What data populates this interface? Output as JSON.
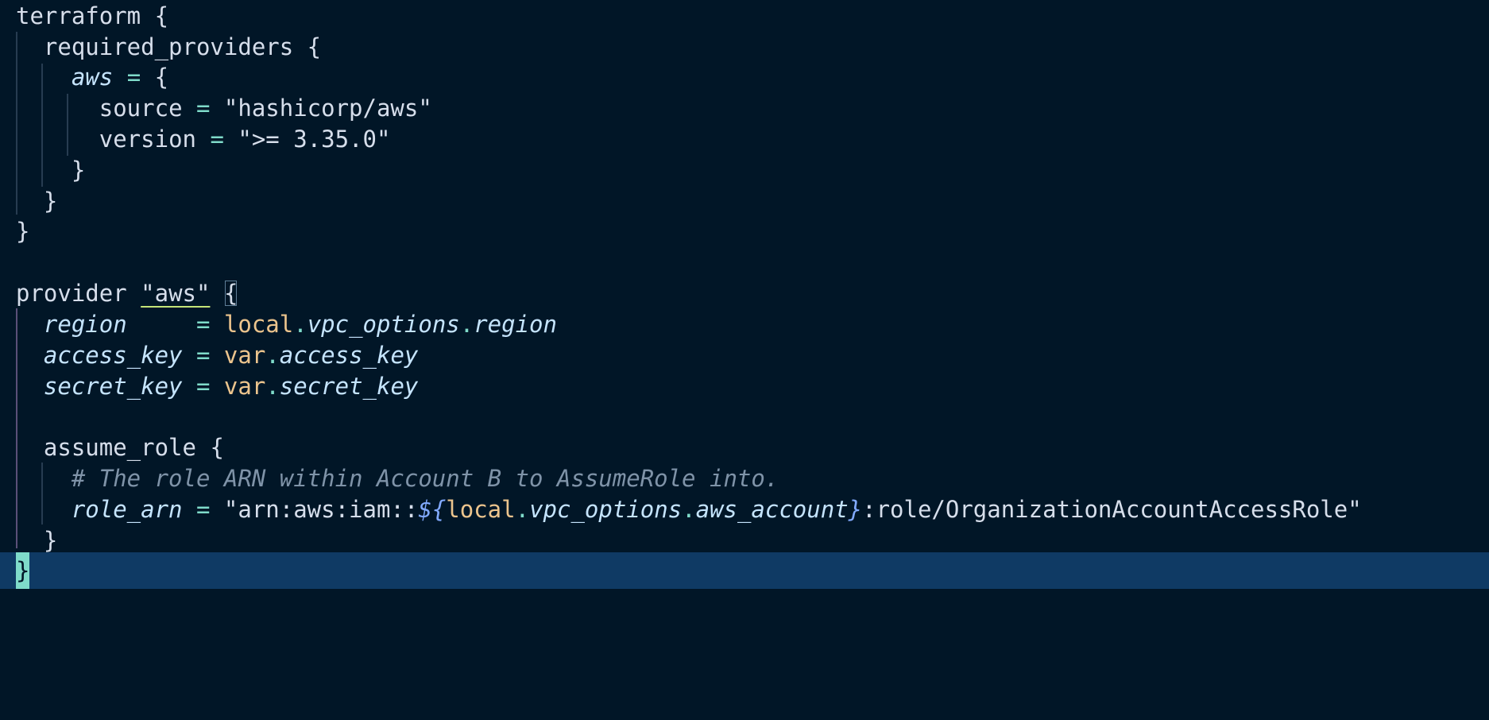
{
  "editor": {
    "lines": [
      [
        "terraform",
        " {"
      ],
      [
        "required_providers",
        " {"
      ],
      [
        "aws",
        " = ",
        "{"
      ],
      [
        "source",
        " = ",
        "\"hashicorp/aws\""
      ],
      [
        "version",
        " = ",
        "\">= 3.35.0\""
      ],
      [
        "}"
      ],
      [
        "}"
      ],
      [
        "}"
      ],
      [
        ""
      ],
      [
        "provider",
        " ",
        "\"aws\"",
        " ",
        "{"
      ],
      [
        "region",
        "     = ",
        "local",
        ".",
        "vpc_options",
        ".",
        "region"
      ],
      [
        "access_key",
        " = ",
        "var",
        ".",
        "access_key"
      ],
      [
        "secret_key",
        " = ",
        "var",
        ".",
        "secret_key"
      ],
      [
        ""
      ],
      [
        "assume_role",
        " {"
      ],
      [
        "# The role ARN within Account B to AssumeRole into."
      ],
      [
        "role_arn",
        " = ",
        "\"arn:aws:iam::",
        "${",
        "local",
        ".",
        "vpc_options",
        ".",
        "aws_account",
        "}",
        ":role/OrganizationAccountAccessRole\""
      ],
      [
        "}"
      ],
      [
        "}"
      ]
    ]
  },
  "colors": {
    "background": "#011627",
    "current_line": "#0f3a64",
    "string": "#ecc48d",
    "operator": "#7fdbca",
    "interpolation": "#82aaff",
    "comment": "#7f93a8"
  }
}
